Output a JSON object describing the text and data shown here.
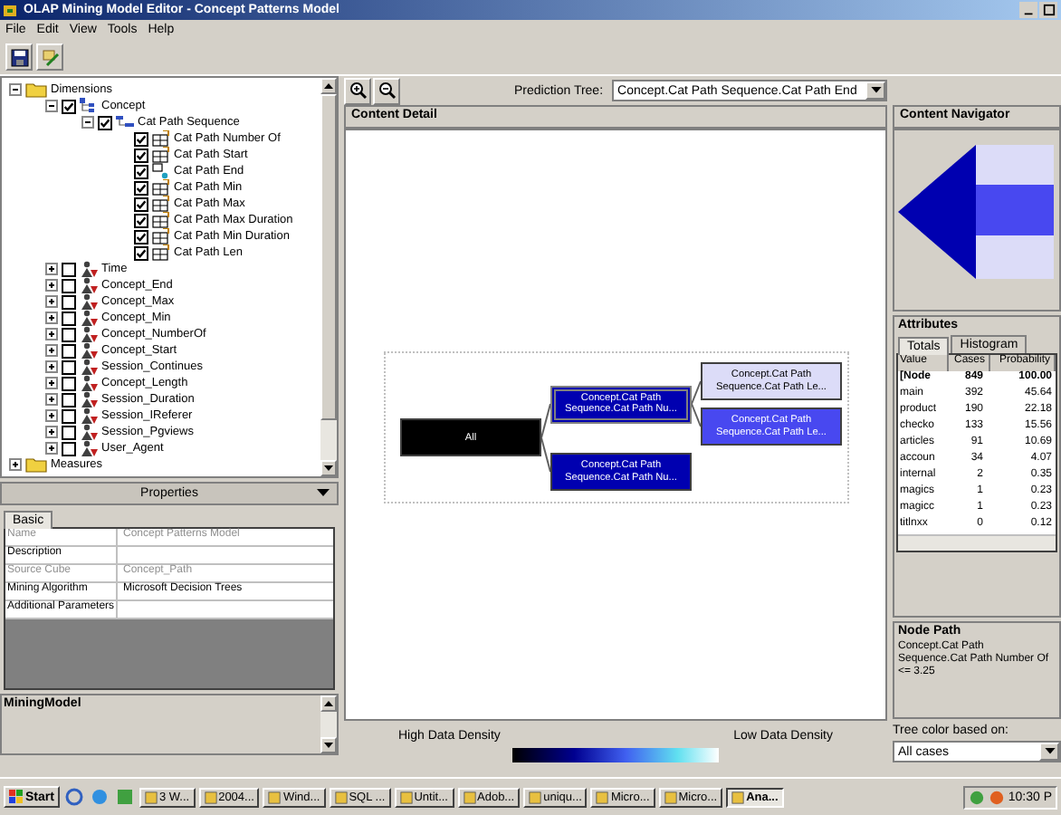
{
  "window": {
    "title": "OLAP Mining Model Editor - Concept Patterns Model"
  },
  "menu": [
    "File",
    "Edit",
    "View",
    "Tools",
    "Help"
  ],
  "tree": [
    {
      "label": "Dimensions",
      "kind": "folder",
      "expanded": true,
      "children": [
        {
          "label": "Concept",
          "kind": "dimension",
          "checked": true,
          "expanded": true,
          "children": [
            {
              "label": "Cat Path Sequence",
              "kind": "level",
              "checked": true,
              "expanded": true,
              "children": [
                {
                  "label": "Cat Path Number Of",
                  "kind": "attribute",
                  "checked": true
                },
                {
                  "label": "Cat Path Start",
                  "kind": "attribute",
                  "checked": true
                },
                {
                  "label": "Cat Path End",
                  "kind": "key",
                  "checked": true
                },
                {
                  "label": "Cat Path Min",
                  "kind": "attribute",
                  "checked": true
                },
                {
                  "label": "Cat Path Max",
                  "kind": "attribute",
                  "checked": true
                },
                {
                  "label": "Cat Path Max Duration",
                  "kind": "attribute",
                  "checked": true
                },
                {
                  "label": "Cat Path Min Duration",
                  "kind": "attribute",
                  "checked": true
                },
                {
                  "label": "Cat Path Len",
                  "kind": "attribute",
                  "checked": true
                }
              ]
            }
          ]
        },
        {
          "label": "Time",
          "kind": "dimension",
          "checked": false,
          "expanded": false
        },
        {
          "label": "Concept_End",
          "kind": "dimension",
          "checked": false,
          "expanded": false
        },
        {
          "label": "Concept_Max",
          "kind": "dimension",
          "checked": false,
          "expanded": false
        },
        {
          "label": "Concept_Min",
          "kind": "dimension",
          "checked": false,
          "expanded": false
        },
        {
          "label": "Concept_NumberOf",
          "kind": "dimension",
          "checked": false,
          "expanded": false
        },
        {
          "label": "Concept_Start",
          "kind": "dimension",
          "checked": false,
          "expanded": false
        },
        {
          "label": "Session_Continues",
          "kind": "dimension",
          "checked": false,
          "expanded": false
        },
        {
          "label": "Concept_Length",
          "kind": "dimension",
          "checked": false,
          "expanded": false
        },
        {
          "label": "Session_Duration",
          "kind": "dimension",
          "checked": false,
          "expanded": false
        },
        {
          "label": "Session_IReferer",
          "kind": "dimension",
          "checked": false,
          "expanded": false
        },
        {
          "label": "Session_Pgviews",
          "kind": "dimension",
          "checked": false,
          "expanded": false
        },
        {
          "label": "User_Agent",
          "kind": "dimension",
          "checked": false,
          "expanded": false
        }
      ]
    },
    {
      "label": "Measures",
      "kind": "folder",
      "expanded": false
    }
  ],
  "properties": {
    "title": "Properties",
    "tabs": [
      {
        "label": "Basic",
        "selected": true
      }
    ],
    "rows": [
      {
        "name": "Name",
        "value": "Concept Patterns Model",
        "disabled": true
      },
      {
        "name": "Description",
        "value": "",
        "disabled": false
      },
      {
        "name": "Source Cube",
        "value": "Concept_Path",
        "disabled": true
      },
      {
        "name": "Mining Algorithm",
        "value": "Microsoft Decision Trees",
        "disabled": false
      },
      {
        "name": "Additional Parameters",
        "value": "",
        "disabled": false
      }
    ]
  },
  "description_panel": {
    "title": "MiningModel"
  },
  "prediction_tree": {
    "label": "Prediction Tree:",
    "value": "Concept.Cat Path Sequence.Cat Path End"
  },
  "content_detail": {
    "title": "Content Detail",
    "tree": {
      "label": "All",
      "color": "#000000",
      "selected": false,
      "children": [
        {
          "label": "Concept.Cat Path Sequence.Cat Path Nu...",
          "color": "#0000b0",
          "selected": true,
          "children": [
            {
              "label": "Concept.Cat Path Sequence.Cat Path Le...",
              "color": "#dcdcf8",
              "selected": false
            },
            {
              "label": "Concept.Cat Path Sequence.Cat Path Le...",
              "color": "#4848f0",
              "selected": false
            }
          ]
        },
        {
          "label": "Concept.Cat Path Sequence.Cat Path Nu...",
          "color": "#0000b0",
          "selected": false
        }
      ]
    }
  },
  "legend": {
    "high": "High Data Density",
    "low": "Low Data Density"
  },
  "tree_color": {
    "label": "Tree color based on:",
    "value": "All cases"
  },
  "content_navigator": {
    "title": "Content Navigator"
  },
  "attributes": {
    "title": "Attributes",
    "tabs": [
      {
        "label": "Totals",
        "selected": true
      },
      {
        "label": "Histogram",
        "selected": false
      }
    ],
    "columns": [
      "Value",
      "Cases",
      "Probability"
    ],
    "rows": [
      {
        "kind": "total",
        "value": "[Node",
        "cases": "849",
        "probability": "100.00"
      },
      {
        "kind": "value",
        "value": "main",
        "cases": "392",
        "probability": "45.64"
      },
      {
        "kind": "value",
        "value": "product",
        "cases": "190",
        "probability": "22.18"
      },
      {
        "kind": "value",
        "value": "checko",
        "cases": "133",
        "probability": "15.56"
      },
      {
        "kind": "value",
        "value": "articles",
        "cases": "91",
        "probability": "10.69"
      },
      {
        "kind": "value",
        "value": "accoun",
        "cases": "34",
        "probability": "4.07"
      },
      {
        "kind": "value",
        "value": "internal",
        "cases": "2",
        "probability": "0.35"
      },
      {
        "kind": "value",
        "value": "magics",
        "cases": "1",
        "probability": "0.23"
      },
      {
        "kind": "value",
        "value": "magicc",
        "cases": "1",
        "probability": "0.23"
      },
      {
        "kind": "value",
        "value": "titlnxx",
        "cases": "0",
        "probability": "0.12"
      }
    ]
  },
  "node_path": {
    "title": "Node Path",
    "text": "Concept.Cat Path Sequence.Cat Path Number Of <= 3.25"
  },
  "taskbar": {
    "start": "Start",
    "buttons": [
      {
        "label": "3 W...",
        "selected": false
      },
      {
        "label": "2004...",
        "selected": false
      },
      {
        "label": "Wind...",
        "selected": false
      },
      {
        "label": "SQL ...",
        "selected": false
      },
      {
        "label": "Untit...",
        "selected": false
      },
      {
        "label": "Adob...",
        "selected": false
      },
      {
        "label": "uniqu...",
        "selected": false
      },
      {
        "label": "Micro...",
        "selected": false
      },
      {
        "label": "Micro...",
        "selected": false
      },
      {
        "label": "Ana...",
        "selected": true
      }
    ],
    "clock": "10:30 P"
  }
}
